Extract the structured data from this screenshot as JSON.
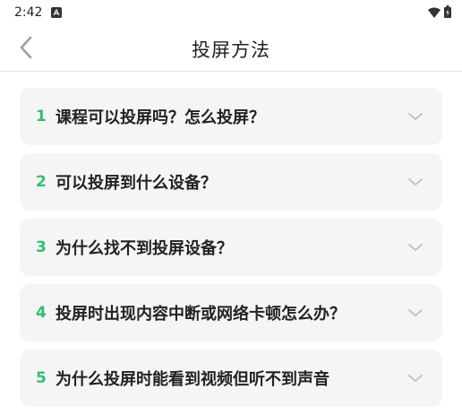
{
  "status_bar": {
    "time": "2:42",
    "notification_icon": "notification-a-icon",
    "wifi_icon": "wifi-icon",
    "battery_icon": "battery-charging-icon"
  },
  "header": {
    "title": "投屏方法",
    "back_icon": "chevron-left-icon"
  },
  "faq": {
    "items": [
      {
        "number": "1",
        "question": "课程可以投屏吗？怎么投屏？"
      },
      {
        "number": "2",
        "question": "可以投屏到什么设备？"
      },
      {
        "number": "3",
        "question": "为什么找不到投屏设备？"
      },
      {
        "number": "4",
        "question": "投屏时出现内容中断或网络卡顿怎么办？"
      },
      {
        "number": "5",
        "question": "为什么投屏时能看到视频但听不到声音"
      }
    ]
  },
  "colors": {
    "accent": "#2fbf71",
    "card_bg": "#f5f5f5",
    "text": "#222222",
    "chevron": "#bdbdbd"
  }
}
